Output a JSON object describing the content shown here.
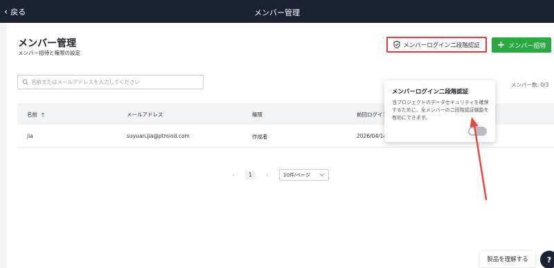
{
  "header": {
    "back_label": "戻る",
    "title": "メンバー管理"
  },
  "page": {
    "title": "メンバー管理",
    "subtitle": "メンバー招待と権限の設定"
  },
  "buttons": {
    "two_factor": "メンバーログイン二段階認証",
    "invite": "メンバー招待"
  },
  "search": {
    "placeholder": "名前またはメールアドレスを入力してください"
  },
  "member_count": "メンバー数: 0/3",
  "table": {
    "headers": [
      "名前",
      "メールアドレス",
      "権限",
      "前回ログイン"
    ],
    "rows": [
      {
        "name": "jia",
        "email": "suyuan.jia@ptmind.com",
        "role": "作成者",
        "last_login": "2026/04/14"
      }
    ]
  },
  "pagination": {
    "current_page": "1",
    "page_size": "10件/ページ"
  },
  "popover": {
    "title": "メンバーログイン二段階認証",
    "body": "当プロジェクトのデータセキュリティを確保するために、全メンバーの二段階認証機能を有効にできます。",
    "toggle_enabled": false
  },
  "help": {
    "label": "製品を理解する",
    "icon_text": "?"
  },
  "colors": {
    "topbar": "#1b2233",
    "accent_green": "#2aa943",
    "highlight_red": "#e4393c",
    "annotation_arrow": "#e8493f"
  },
  "icons": {
    "back": "chevron-left-icon",
    "shield": "shield-icon",
    "plus": "plus-icon",
    "search": "search-icon",
    "sort": "sort-icon"
  }
}
